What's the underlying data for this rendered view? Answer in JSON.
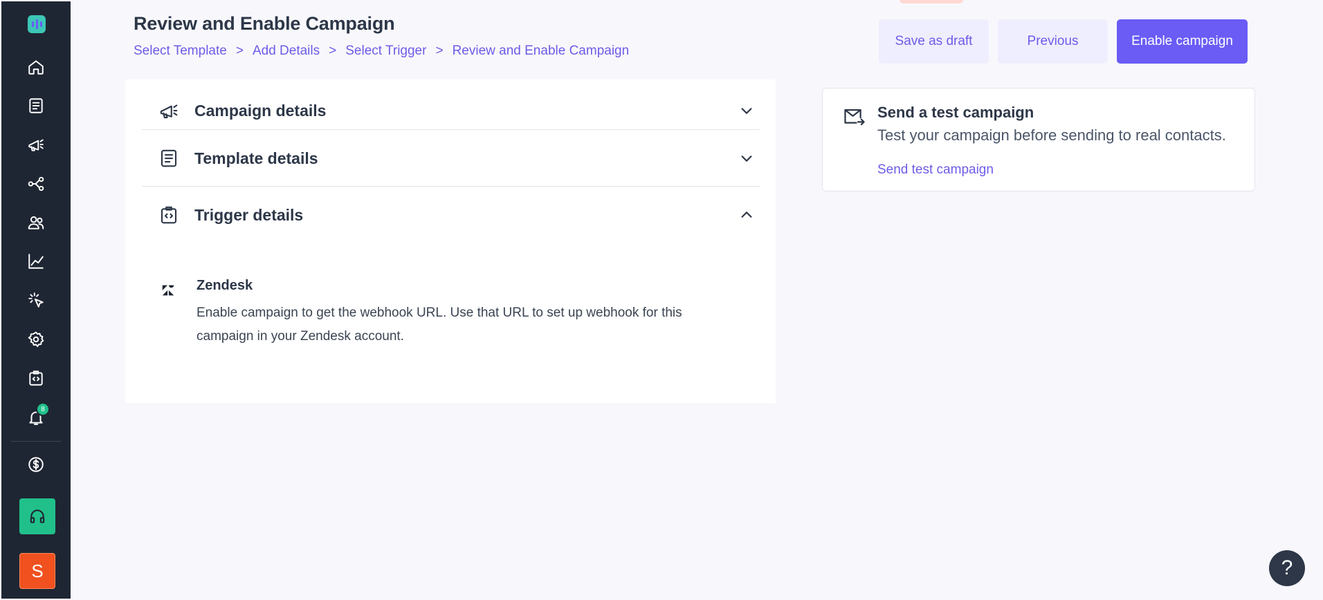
{
  "header": {
    "title": "Review and Enable Campaign",
    "breadcrumb": [
      "Select Template",
      "Add Details",
      "Select Trigger",
      "Review and Enable Campaign"
    ],
    "breadcrumb_separator": ">",
    "buttons": {
      "save_draft": "Save as draft",
      "previous": "Previous",
      "enable": "Enable campaign"
    }
  },
  "sidebar": {
    "items": [
      {
        "icon": "home-icon"
      },
      {
        "icon": "template-icon"
      },
      {
        "icon": "campaign-megaphone-icon"
      },
      {
        "icon": "flow-icon"
      },
      {
        "icon": "contacts-icon"
      },
      {
        "icon": "analytics-icon"
      },
      {
        "icon": "click-icon"
      },
      {
        "icon": "settings-icon"
      },
      {
        "icon": "integration-icon"
      },
      {
        "icon": "bell-icon",
        "badge": "8"
      }
    ],
    "billing_icon": "dollar-icon",
    "support_icon": "headphones-icon",
    "avatar_letter": "S"
  },
  "accordion": {
    "campaign_details": "Campaign details",
    "template_details": "Template details",
    "trigger_details": "Trigger details",
    "trigger": {
      "provider": "Zendesk",
      "description": "Enable campaign to get the webhook URL. Use that URL to set up webhook for this campaign in your Zendesk account."
    }
  },
  "test_campaign": {
    "title": "Send a test campaign",
    "subtitle": "Test your campaign before sending to real contacts.",
    "link": "Send test campaign"
  },
  "help": {
    "label": "?"
  },
  "colors": {
    "sidebar_bg": "#1f2633",
    "accent": "#6a5cf5",
    "accent_light": "#efeefe",
    "link": "#6c5ce7",
    "success": "#21c08b",
    "avatar_bg": "#f0511f",
    "page_bg": "#f8f8fc"
  }
}
